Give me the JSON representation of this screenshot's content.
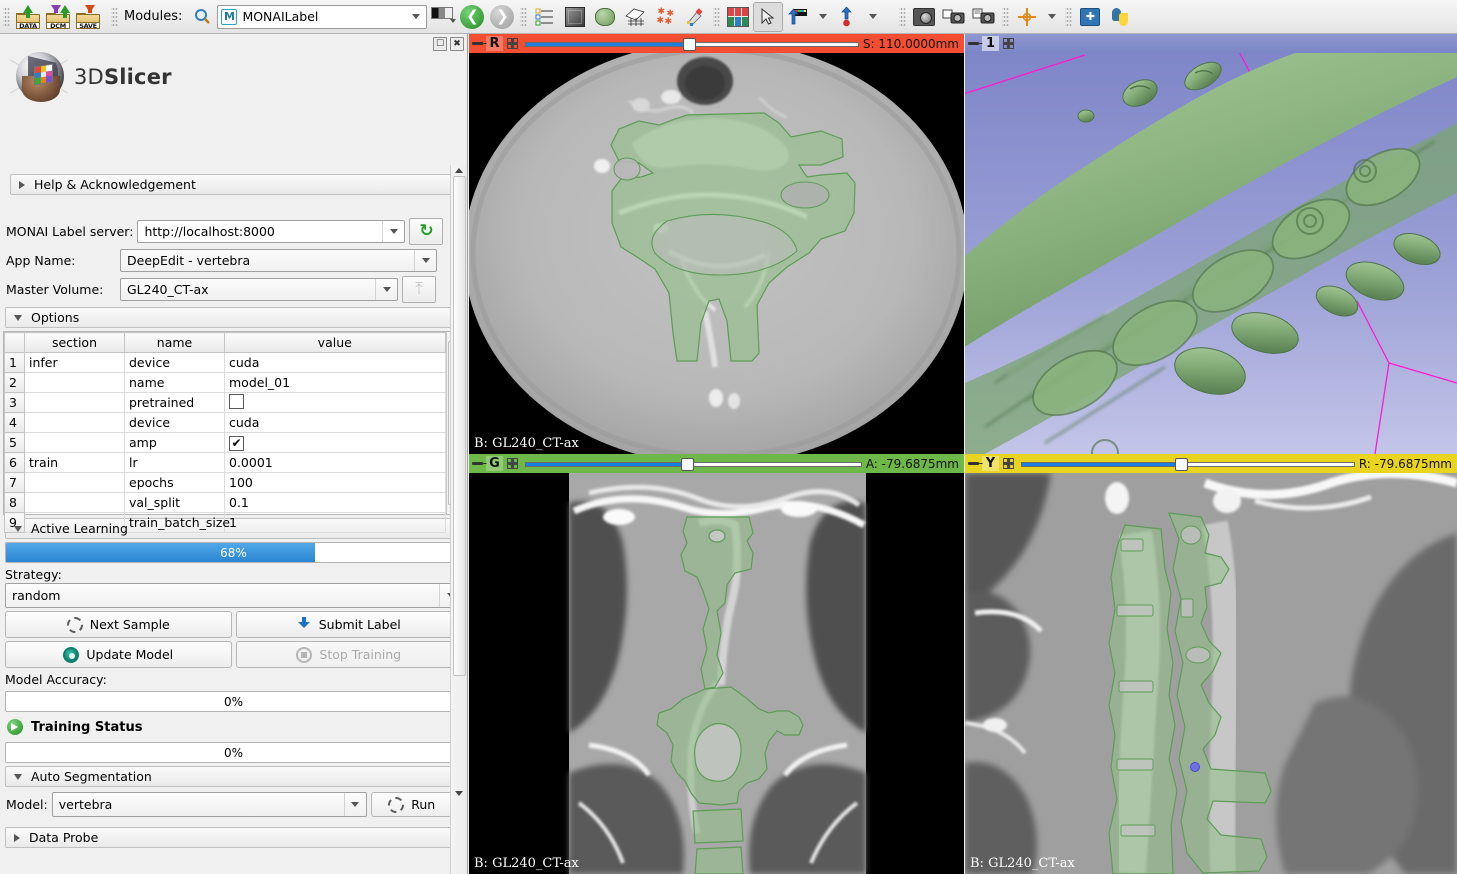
{
  "toolbar": {
    "modules_label": "Modules:",
    "search_icon": "search-icon",
    "module_selected": "MONAILabel",
    "buttons": [
      {
        "name": "load-data-button",
        "label": "DATA"
      },
      {
        "name": "load-dicom-button",
        "label": "DCM"
      },
      {
        "name": "save-data-button",
        "label": "SAVE"
      }
    ]
  },
  "panel": {
    "logo_text_prefix": "3D",
    "logo_text_suffix": "Slicer",
    "help_section": "Help & Acknowledgement",
    "server_label": "MONAI Label server:",
    "server_value": "http://localhost:8000",
    "app_name_label": "App Name:",
    "app_name_value": "DeepEdit - vertebra",
    "master_volume_label": "Master Volume:",
    "master_volume_value": "GL240_CT-ax",
    "options_section": "Options",
    "options_table": {
      "columns": [
        "section",
        "name",
        "value"
      ],
      "rows": [
        {
          "index": "1",
          "section": "infer",
          "name": "device",
          "value": "cuda",
          "type": "text"
        },
        {
          "index": "2",
          "section": "",
          "name": "name",
          "value": "model_01",
          "type": "text"
        },
        {
          "index": "3",
          "section": "",
          "name": "pretrained",
          "value": "",
          "type": "checkbox",
          "checked": false
        },
        {
          "index": "4",
          "section": "",
          "name": "device",
          "value": "cuda",
          "type": "text"
        },
        {
          "index": "5",
          "section": "",
          "name": "amp",
          "value": "",
          "type": "checkbox",
          "checked": true
        },
        {
          "index": "6",
          "section": "train",
          "name": "lr",
          "value": "0.0001",
          "type": "text"
        },
        {
          "index": "7",
          "section": "",
          "name": "epochs",
          "value": "100",
          "type": "text"
        },
        {
          "index": "8",
          "section": "",
          "name": "val_split",
          "value": "0.1",
          "type": "text"
        },
        {
          "index": "9",
          "section": "",
          "name": "train_batch_size",
          "value": "1",
          "type": "text"
        }
      ]
    },
    "active_learning_section": "Active Learning",
    "active_learning_progress": "68%",
    "active_learning_progress_value": 68,
    "strategy_label": "Strategy:",
    "strategy_value": "random",
    "next_sample_button": "Next Sample",
    "submit_label_button": "Submit Label",
    "update_model_button": "Update Model",
    "stop_training_button": "Stop Training",
    "model_accuracy_label": "Model Accuracy:",
    "model_accuracy_progress": "0%",
    "model_accuracy_value": 0,
    "training_status_section": "Training Status",
    "training_progress": "0%",
    "training_progress_value": 0,
    "auto_segmentation_section": "Auto Segmentation",
    "model_label": "Model:",
    "model_value": "vertebra",
    "run_button": "Run",
    "data_probe_section": "Data Probe"
  },
  "views": {
    "axial": {
      "letter": "R",
      "value": "S: 110.0000mm",
      "corner": "B: GL240_CT-ax",
      "accent": "#f34e32",
      "slider_pct": 49
    },
    "threed": {
      "letter": "1",
      "value": "",
      "corner": "",
      "accent": "#7b86c6"
    },
    "coronal": {
      "letter": "G",
      "value": "A: -79.6875mm",
      "corner": "B: GL240_CT-ax",
      "accent": "#6eb84a",
      "slider_pct": 48
    },
    "sagittal": {
      "letter": "Y",
      "value": "R: -79.6875mm",
      "corner": "B: GL240_CT-ax",
      "accent": "#e9d51f",
      "slider_pct": 48
    }
  },
  "colors": {
    "segment_green": "#8fbf87",
    "slider_blue": "#1a7fe0",
    "progress_blue": "#2a86d2",
    "magenta_line": "#ff19d0"
  }
}
